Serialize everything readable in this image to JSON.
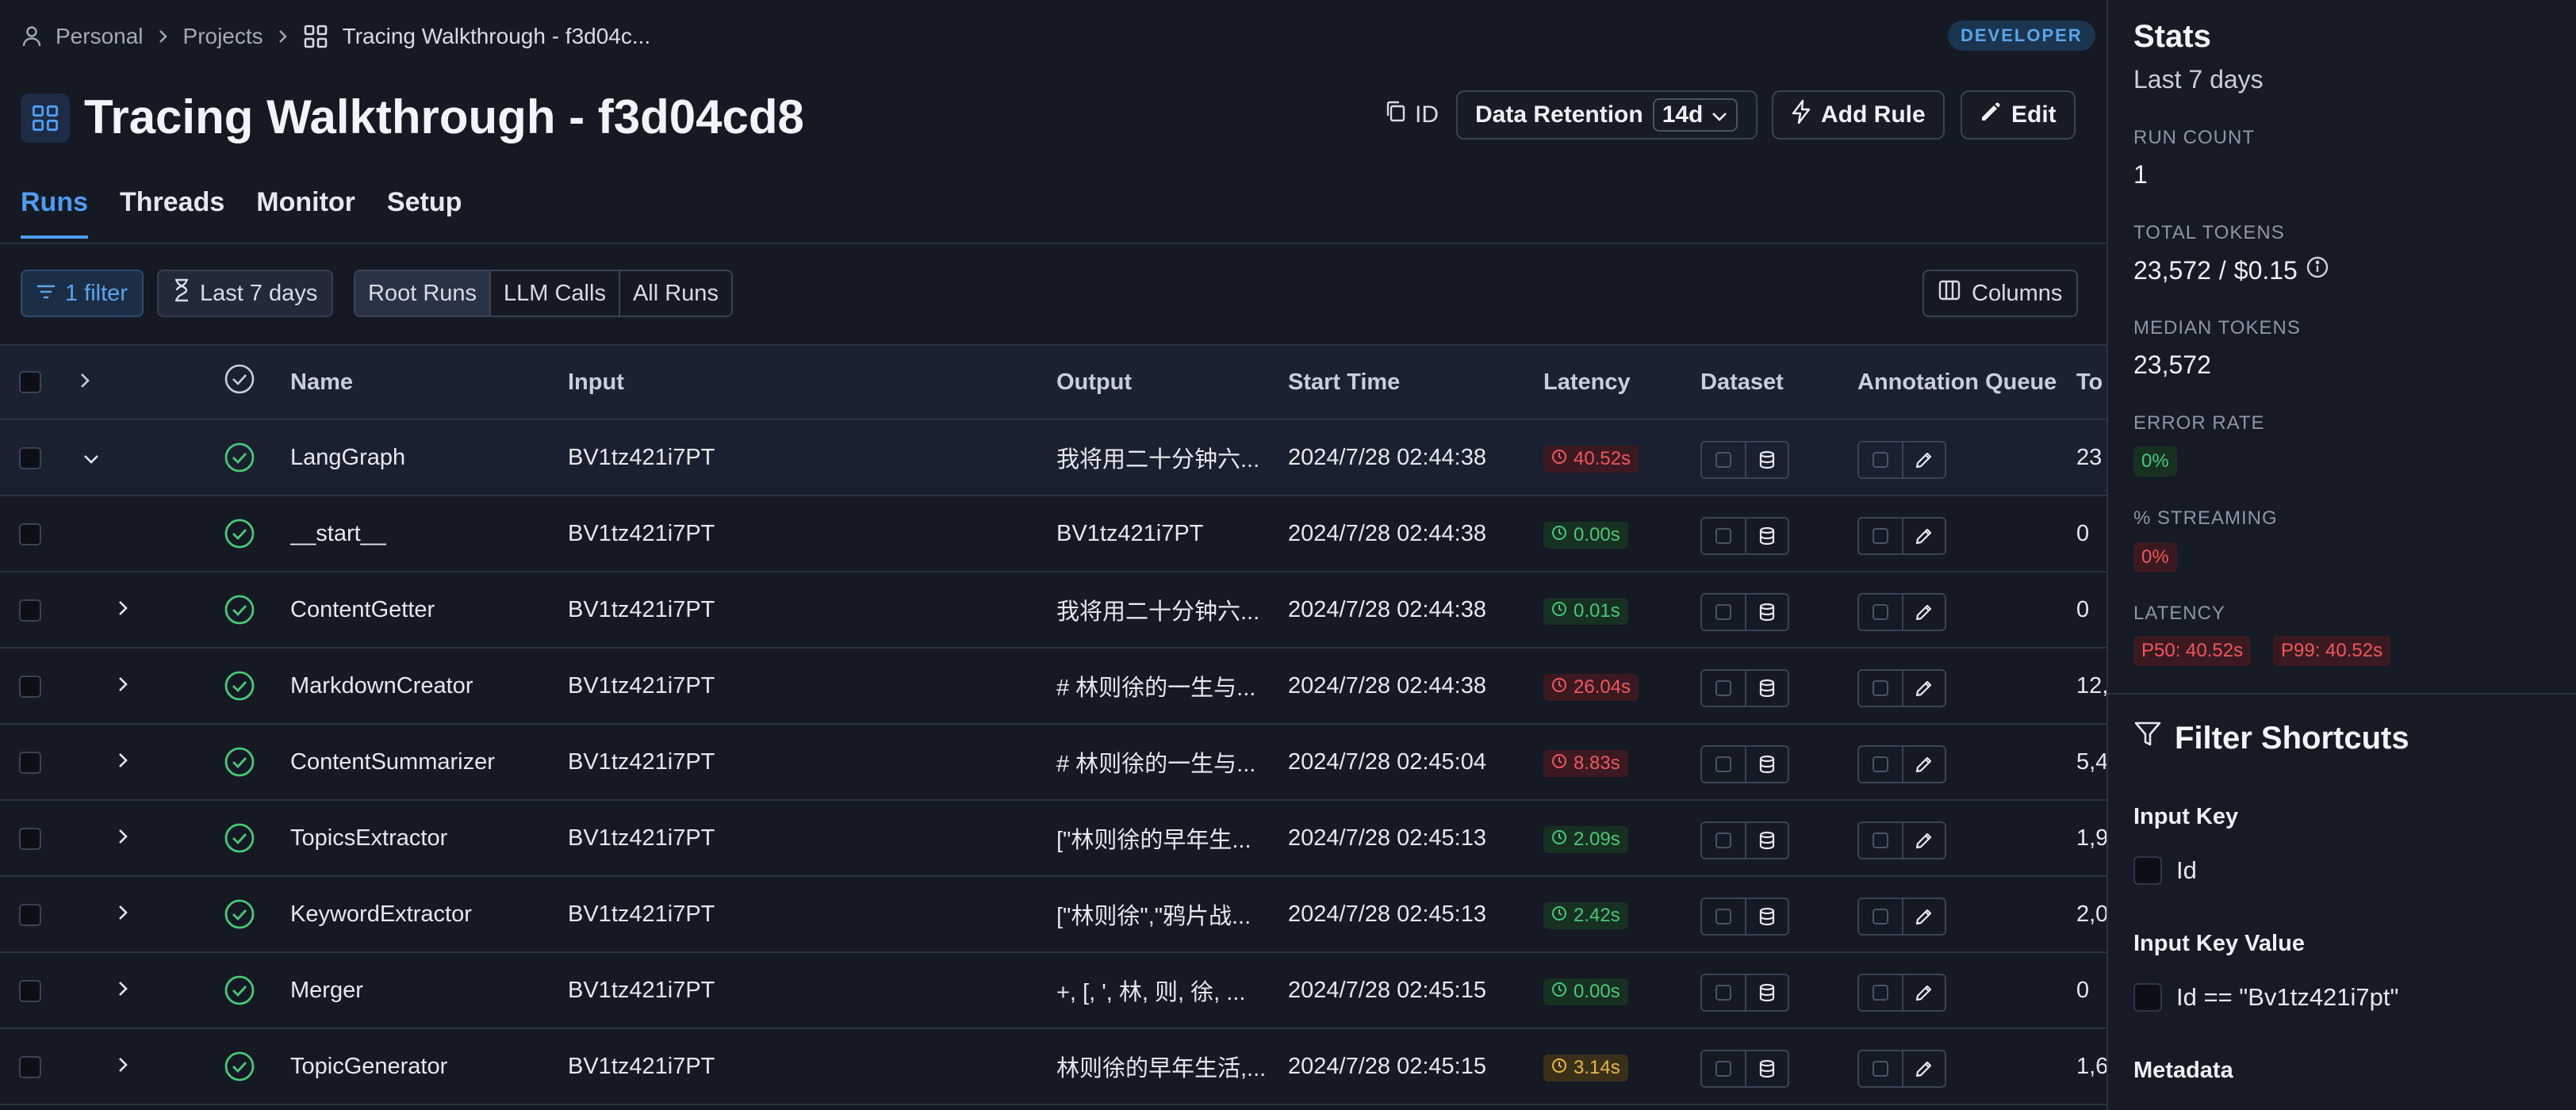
{
  "breadcrumb": {
    "personal": "Personal",
    "projects": "Projects",
    "current": "Tracing Walkthrough - f3d04c..."
  },
  "badge": "DEVELOPER",
  "title": "Tracing Walkthrough - f3d04cd8",
  "header_actions": {
    "id_label": "ID",
    "retention_label": "Data Retention",
    "retention_value": "14d",
    "add_rule": "Add Rule",
    "edit": "Edit"
  },
  "tabs": [
    "Runs",
    "Threads",
    "Monitor",
    "Setup"
  ],
  "active_tab": "Runs",
  "filters": {
    "filter_chip": "1 filter",
    "time_chip": "Last 7 days",
    "segments": [
      "Root Runs",
      "LLM Calls",
      "All Runs"
    ],
    "active_segment": "Root Runs",
    "columns": "Columns"
  },
  "columns": [
    "Name",
    "Input",
    "Output",
    "Start Time",
    "Latency",
    "Dataset",
    "Annotation Queue",
    "To"
  ],
  "rows": [
    {
      "name": "LangGraph",
      "input": "BV1tz421i7PT",
      "output": "我将用二十分钟六...",
      "start": "2024/7/28 02:44:38",
      "latency": "40.52s",
      "lat_color": "red",
      "tokens": "23",
      "expander": "down"
    },
    {
      "name": "__start__",
      "input": "BV1tz421i7PT",
      "output": "BV1tz421i7PT",
      "start": "2024/7/28 02:44:38",
      "latency": "0.00s",
      "lat_color": "green",
      "tokens": "0",
      "expander": "none"
    },
    {
      "name": "ContentGetter",
      "input": "BV1tz421i7PT",
      "output": "我将用二十分钟六...",
      "start": "2024/7/28 02:44:38",
      "latency": "0.01s",
      "lat_color": "green",
      "tokens": "0",
      "expander": "right"
    },
    {
      "name": "MarkdownCreator",
      "input": "BV1tz421i7PT",
      "output": "# 林则徐的一生与...",
      "start": "2024/7/28 02:44:38",
      "latency": "26.04s",
      "lat_color": "red",
      "tokens": "12,",
      "expander": "right"
    },
    {
      "name": "ContentSummarizer",
      "input": "BV1tz421i7PT",
      "output": "# 林则徐的一生与...",
      "start": "2024/7/28 02:45:04",
      "latency": "8.83s",
      "lat_color": "red",
      "tokens": "5,4",
      "expander": "right"
    },
    {
      "name": "TopicsExtractor",
      "input": "BV1tz421i7PT",
      "output": "[\"林则徐的早年生...",
      "start": "2024/7/28 02:45:13",
      "latency": "2.09s",
      "lat_color": "green",
      "tokens": "1,9",
      "expander": "right"
    },
    {
      "name": "KeywordExtractor",
      "input": "BV1tz421i7PT",
      "output": "[\"林则徐\",\"鸦片战...",
      "start": "2024/7/28 02:45:13",
      "latency": "2.42s",
      "lat_color": "green",
      "tokens": "2,0",
      "expander": "right"
    },
    {
      "name": "Merger",
      "input": "BV1tz421i7PT",
      "output": "+, [, ', 林, 则, 徐, ...",
      "start": "2024/7/28 02:45:15",
      "latency": "0.00s",
      "lat_color": "green",
      "tokens": "0",
      "expander": "right"
    },
    {
      "name": "TopicGenerator",
      "input": "BV1tz421i7PT",
      "output": "林则徐的早年生活,...",
      "start": "2024/7/28 02:45:15",
      "latency": "3.14s",
      "lat_color": "yellow",
      "tokens": "1,6",
      "expander": "right"
    }
  ],
  "stats": {
    "title": "Stats",
    "period": "Last 7 days",
    "run_count_label": "RUN COUNT",
    "run_count": "1",
    "total_tokens_label": "TOTAL TOKENS",
    "total_tokens": "23,572",
    "total_cost": "$0.15",
    "median_tokens_label": "MEDIAN TOKENS",
    "median_tokens": "23,572",
    "error_rate_label": "ERROR RATE",
    "error_rate": "0%",
    "streaming_label": "% STREAMING",
    "streaming": "0%",
    "latency_label": "LATENCY",
    "p50": "P50: 40.52s",
    "p99": "P99: 40.52s"
  },
  "filter_shortcuts": {
    "title": "Filter Shortcuts",
    "input_key_label": "Input Key",
    "input_key_option": "Id",
    "input_key_value_label": "Input Key Value",
    "input_key_value_option": "Id == \"Bv1tz421i7pt\"",
    "metadata_label": "Metadata"
  },
  "colors": {
    "accent": "#4f9cf0",
    "latency_red": "#f0565e",
    "latency_green": "#49c77a",
    "latency_yellow": "#e6b740"
  }
}
